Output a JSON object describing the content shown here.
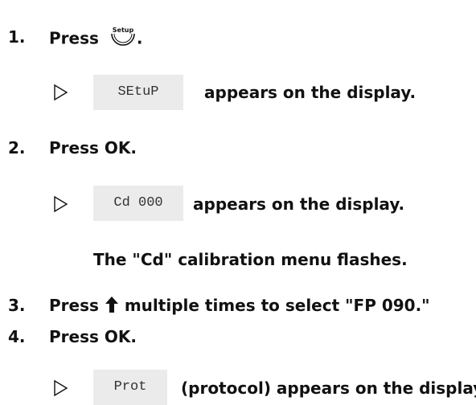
{
  "steps": [
    {
      "number": "1.",
      "text_before": "Press",
      "button_icon": "setup-button-icon",
      "button_label": "Setup",
      "text_after": "."
    },
    {
      "number": "2.",
      "text": "Press OK."
    },
    {
      "number": "3.",
      "text_before": "Press",
      "arrow_icon": "up-arrow-icon",
      "text_after": "multiple times to select \"FP 090.\""
    },
    {
      "number": "4.",
      "text": "Press OK."
    }
  ],
  "results": [
    {
      "display": "SEtuP",
      "text": "appears on the display."
    },
    {
      "display": "Cd 000",
      "text": "appears on the display."
    },
    {
      "display": "Prot",
      "text": "(protocol) appears on the display."
    }
  ],
  "note": "The \"Cd\" calibration menu flashes."
}
